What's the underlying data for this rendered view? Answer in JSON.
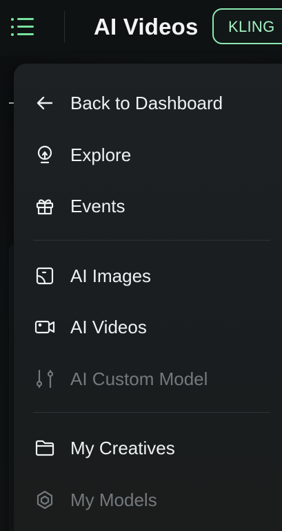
{
  "header": {
    "title": "AI Videos",
    "brand_chip": "KLING"
  },
  "menu": {
    "items": [
      {
        "label": "Back to Dashboard",
        "icon": "arrow-left-icon",
        "enabled": true
      },
      {
        "label": "Explore",
        "icon": "lightbulb-icon",
        "enabled": true
      },
      {
        "label": "Events",
        "icon": "gift-icon",
        "enabled": true
      },
      {
        "label": "AI Images",
        "icon": "image-icon",
        "enabled": true
      },
      {
        "label": "AI Videos",
        "icon": "video-camera-icon",
        "enabled": true
      },
      {
        "label": "AI Custom Model",
        "icon": "sliders-icon",
        "enabled": false
      },
      {
        "label": "My Creatives",
        "icon": "folder-icon",
        "enabled": true
      },
      {
        "label": "My Models",
        "icon": "hexagon-cube-icon",
        "enabled": false
      }
    ]
  },
  "colors": {
    "accent": "#76e3a0",
    "brand_chip_border": "#8ee8b3",
    "drawer_bg": "#1d2123",
    "text": "#eef1f2",
    "text_disabled": "#73797c"
  }
}
